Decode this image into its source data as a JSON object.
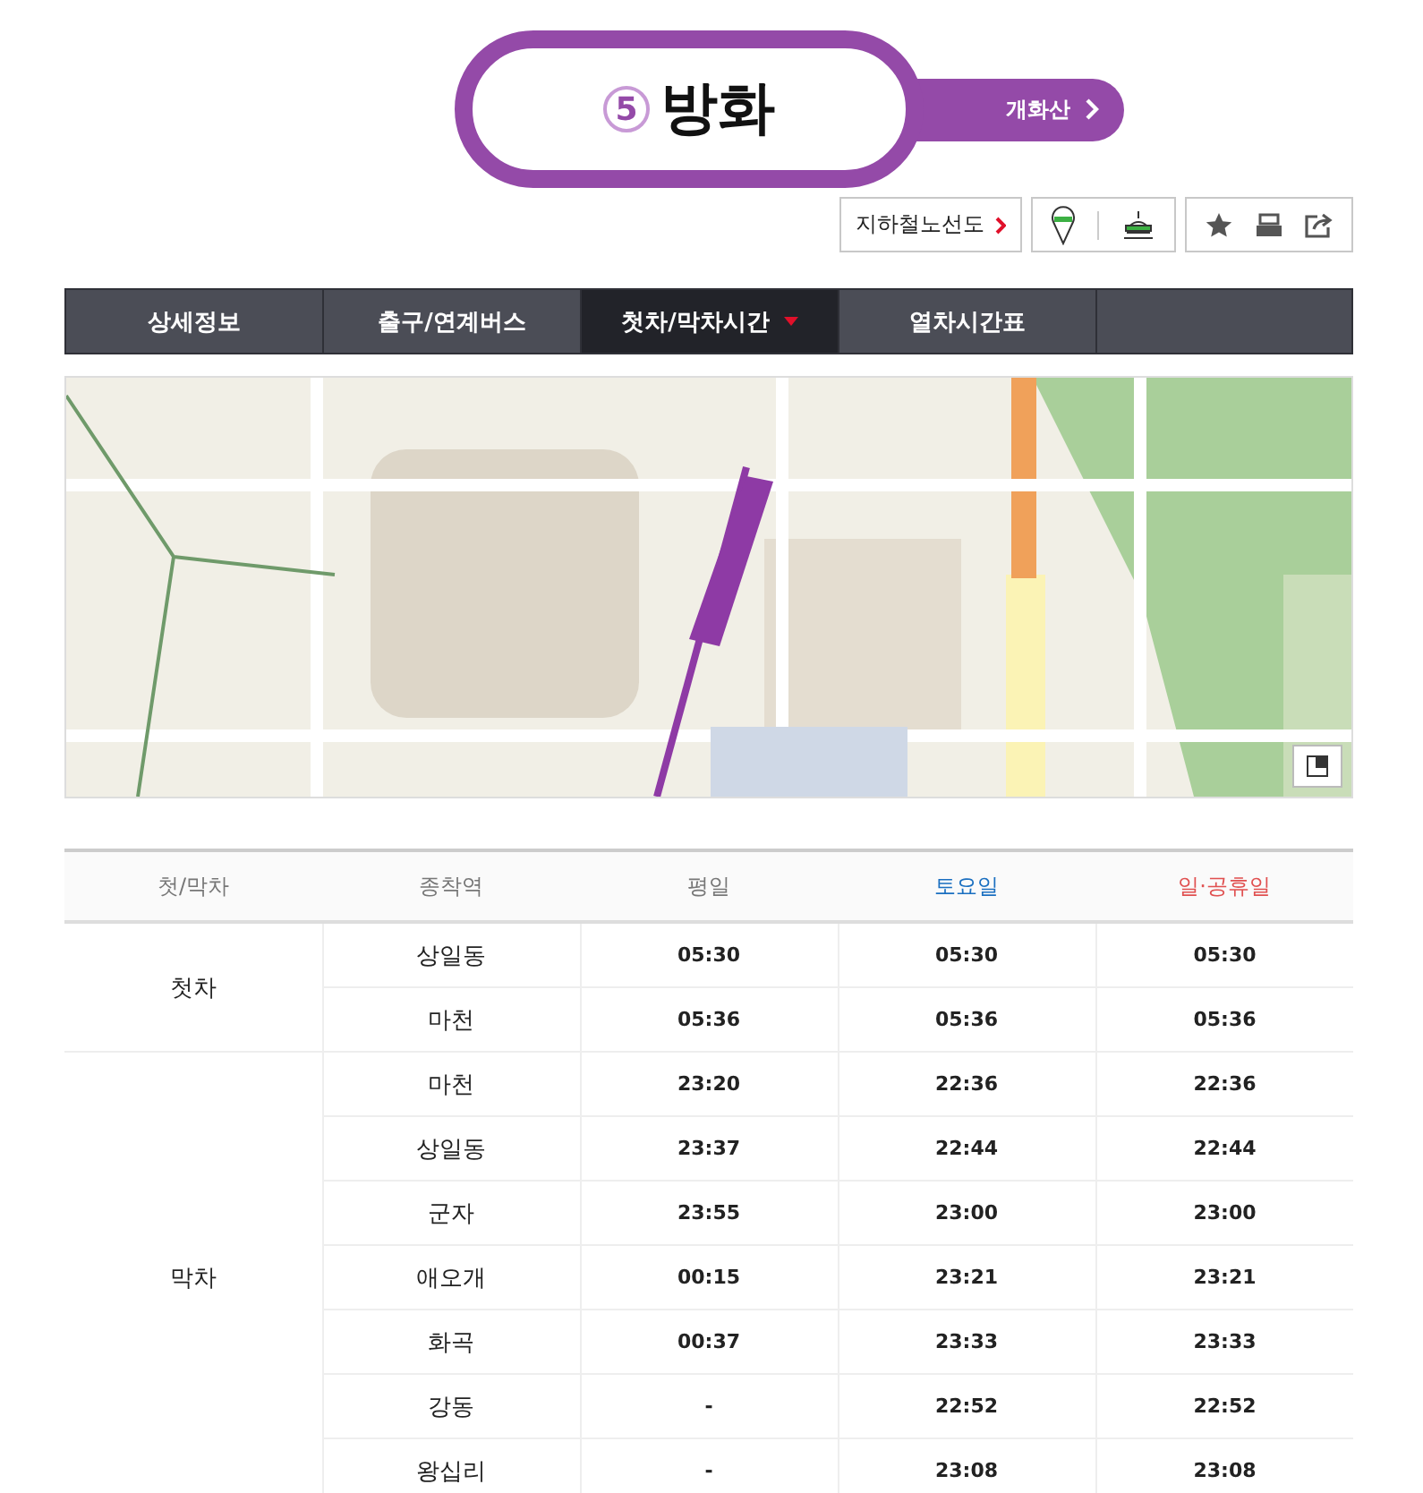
{
  "station": {
    "number": "5",
    "name": "방화",
    "next_station": "개화산"
  },
  "toolbar": {
    "route_map_link": "지하철노선도"
  },
  "tabs": [
    {
      "label": "상세정보",
      "selected": false
    },
    {
      "label": "출구/연계버스",
      "selected": false
    },
    {
      "label": "첫차/막차시간",
      "selected": true
    },
    {
      "label": "열차시간표",
      "selected": false
    }
  ],
  "table": {
    "columns": [
      {
        "label": "첫/막차",
        "kind": "plain"
      },
      {
        "label": "종착역",
        "kind": "plain"
      },
      {
        "label": "평일",
        "kind": "plain"
      },
      {
        "label": "토요일",
        "kind": "saturday"
      },
      {
        "label": "일·공휴일",
        "kind": "holiday"
      }
    ],
    "groups": [
      {
        "label": "첫차",
        "rows": [
          {
            "destination": "상일동",
            "weekday": "05:30",
            "saturday": "05:30",
            "holiday": "05:30"
          },
          {
            "destination": "마천",
            "weekday": "05:36",
            "saturday": "05:36",
            "holiday": "05:36"
          }
        ]
      },
      {
        "label": "막차",
        "rows": [
          {
            "destination": "마천",
            "weekday": "23:20",
            "saturday": "22:36",
            "holiday": "22:36"
          },
          {
            "destination": "상일동",
            "weekday": "23:37",
            "saturday": "22:44",
            "holiday": "22:44"
          },
          {
            "destination": "군자",
            "weekday": "23:55",
            "saturday": "23:00",
            "holiday": "23:00"
          },
          {
            "destination": "애오개",
            "weekday": "00:15",
            "saturday": "23:21",
            "holiday": "23:21"
          },
          {
            "destination": "화곡",
            "weekday": "00:37",
            "saturday": "23:33",
            "holiday": "23:33"
          },
          {
            "destination": "강동",
            "weekday": "-",
            "saturday": "22:52",
            "holiday": "22:52"
          },
          {
            "destination": "왕십리",
            "weekday": "-",
            "saturday": "23:08",
            "holiday": "23:08"
          }
        ]
      }
    ]
  }
}
